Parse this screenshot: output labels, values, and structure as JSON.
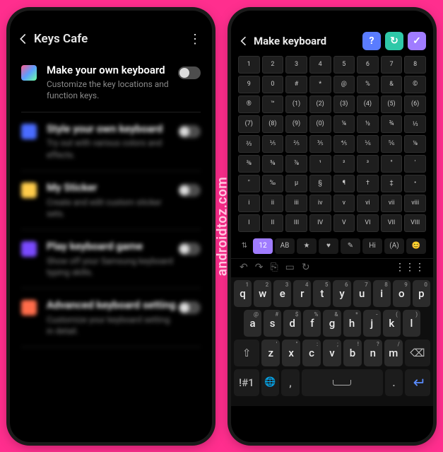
{
  "watermark": "androidtoz.com",
  "left": {
    "header": {
      "title": "Keys Cafe"
    },
    "items": [
      {
        "icon": "grid",
        "title": "Make your own keyboard",
        "sub": "Customize the key locations and function keys.",
        "blur": false
      },
      {
        "icon": "style",
        "title": "Style your own keyboard",
        "sub": "Try out with various colors and effects.",
        "blur": true
      },
      {
        "icon": "stick",
        "title": "My Sticker",
        "sub": "Create and edit custom sticker sets.",
        "blur": true
      },
      {
        "icon": "game",
        "title": "Play keyboard game",
        "sub": "Show off your Samsung keyboard typing skills.",
        "blur": true
      },
      {
        "icon": "adv",
        "title": "Advanced keyboard setting",
        "sub": "Customize your keyboard setting in detail.",
        "blur": true
      }
    ]
  },
  "right": {
    "header": {
      "title": "Make keyboard",
      "actions": {
        "help": "?",
        "refresh": "↻",
        "ok": "✓"
      }
    },
    "palette": [
      [
        "1",
        "2",
        "3",
        "4",
        "5",
        "6",
        "7",
        "8"
      ],
      [
        "9",
        "0",
        "#",
        "*",
        "@",
        "%",
        "&",
        "©"
      ],
      [
        "®",
        "™",
        "(1)",
        "(2)",
        "(3)",
        "(4)",
        "(5)",
        "(6)"
      ],
      [
        "(7)",
        "(8)",
        "(9)",
        "(0)",
        "¼",
        "½",
        "¾",
        "⅓"
      ],
      [
        "⅔",
        "⅕",
        "⅖",
        "⅗",
        "⅘",
        "⅙",
        "⅚",
        "⅛"
      ],
      [
        "⅜",
        "⅝",
        "⅞",
        "¹",
        "²",
        "³",
        "°",
        "′"
      ],
      [
        "″",
        "‰",
        "µ",
        "§",
        "¶",
        "†",
        "‡",
        "•"
      ],
      [
        "i",
        "ii",
        "iii",
        "iv",
        "v",
        "vi",
        "vii",
        "viii"
      ],
      [
        "I",
        "II",
        "III",
        "IV",
        "V",
        "VI",
        "VII",
        "VIII"
      ]
    ],
    "categories": {
      "items": [
        "⇅",
        "12",
        "AB",
        "★",
        "♥",
        "✎",
        "Hi",
        "(A)",
        "😊"
      ],
      "active_index": 1
    },
    "toolbar": [
      "↶",
      "↷",
      "⎘",
      "▭",
      "↻",
      "⋮⋮⋮"
    ],
    "keyboard": {
      "row1": [
        {
          "k": "q",
          "h": "1"
        },
        {
          "k": "w",
          "h": "2"
        },
        {
          "k": "e",
          "h": "3"
        },
        {
          "k": "r",
          "h": "4"
        },
        {
          "k": "t",
          "h": "5"
        },
        {
          "k": "y",
          "h": "6"
        },
        {
          "k": "u",
          "h": "7"
        },
        {
          "k": "i",
          "h": "8"
        },
        {
          "k": "o",
          "h": "9"
        },
        {
          "k": "p",
          "h": "0"
        }
      ],
      "row2": [
        {
          "k": "a",
          "h": "@"
        },
        {
          "k": "s",
          "h": "#"
        },
        {
          "k": "d",
          "h": "$"
        },
        {
          "k": "f",
          "h": "%"
        },
        {
          "k": "g",
          "h": "&"
        },
        {
          "k": "h",
          "h": "*"
        },
        {
          "k": "j",
          "h": "-"
        },
        {
          "k": "k",
          "h": "("
        },
        {
          "k": "l",
          "h": ")"
        }
      ],
      "row3": [
        {
          "k": "⇧",
          "wide": true,
          "dark": true
        },
        {
          "k": "z",
          "h": "'"
        },
        {
          "k": "x",
          "h": "\""
        },
        {
          "k": "c",
          "h": ":"
        },
        {
          "k": "v",
          "h": ";"
        },
        {
          "k": "b",
          "h": "!"
        },
        {
          "k": "n",
          "h": "?"
        },
        {
          "k": "m",
          "h": "/"
        },
        {
          "k": "⌫",
          "wide": true,
          "dark": true
        }
      ],
      "row4": {
        "mode": "!#1",
        "globe": "🌐",
        "comma": ",",
        "period": ".",
        "enter": "↵"
      }
    }
  }
}
